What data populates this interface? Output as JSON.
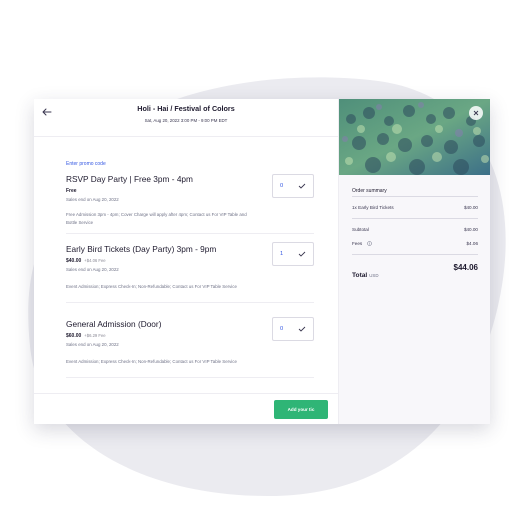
{
  "event": {
    "title": "Holi - Hai / Festival of Colors",
    "date": "Sat, Aug 20, 2022 3:00 PM - 9:00 PM EDT"
  },
  "promo_link": "Enter promo code",
  "tickets": [
    {
      "name": "RSVP Day Party | Free 3pm - 4pm",
      "price": "Free",
      "fee": "",
      "sales": "Sales end on Aug 20, 2022",
      "description_lines": [
        "Free Admission 3pm - 4pm; Cover Charge will apply after 4pm; Contact us For VIP Table and",
        "Bottle Service"
      ],
      "quantity": "0"
    },
    {
      "name": "Early Bird Tickets (Day Party) 3pm - 9pm",
      "price": "$40.00",
      "fee": "+$4.06 Fee",
      "sales": "Sales end on Aug 20, 2022",
      "description_lines": [
        "Event Admission; Express Check-In; Non-Refundable; Contact us For VIP Table Service"
      ],
      "quantity": "1"
    },
    {
      "name": "General Admission (Door)",
      "price": "$60.00",
      "fee": "+$6.29 Fee",
      "sales": "Sales end on Aug 20, 2022",
      "description_lines": [
        "Event Admission; Express Check-In; Non-Refundable; Contact us For VIP Table Service"
      ],
      "quantity": "0"
    }
  ],
  "cta_label": "Add your tic",
  "order_summary": {
    "title": "Order summary",
    "line_item": {
      "label": "1x Early Bird Tickets",
      "amount": "$40.00"
    },
    "subtotal": {
      "label": "Subtotal",
      "amount": "$40.00"
    },
    "fees": {
      "label": "Fees",
      "amount": "$4.06"
    },
    "total": {
      "label": "Total",
      "currency": "USD",
      "amount": "$44.06"
    }
  },
  "colors": {
    "accent_blue": "#3659e3",
    "cta_green": "#2fb576",
    "blob": "#ebebf0"
  },
  "icons": [
    "back-arrow-icon",
    "chevron-down-icon",
    "close-icon",
    "info-icon"
  ]
}
